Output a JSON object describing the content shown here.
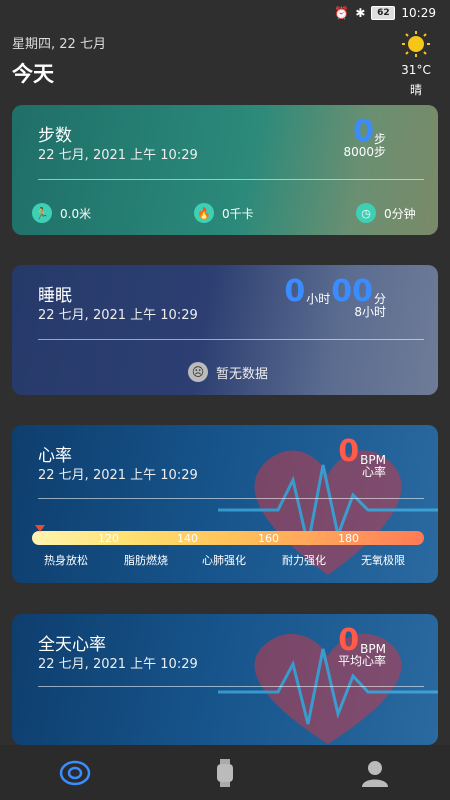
{
  "status": {
    "time": "10:29",
    "battery": "62"
  },
  "header": {
    "date": "星期四, 22 七月",
    "title": "今天"
  },
  "weather": {
    "temp": "31°C",
    "condition": "晴",
    "icon": "sun-icon"
  },
  "steps": {
    "title": "步数",
    "time": "22 七月, 2021 上午 10:29",
    "value": "0",
    "unit": "步",
    "goal": "8000步",
    "distance": "0.0米",
    "calories": "0千卡",
    "duration": "0分钟"
  },
  "sleep": {
    "title": "睡眠",
    "time": "22 七月, 2021 上午 10:29",
    "hours": "0",
    "hours_unit": "小时",
    "minutes": "00",
    "minutes_unit": "分",
    "goal": "8小时",
    "nodata": "暂无数据"
  },
  "heart": {
    "title": "心率",
    "time": "22 七月, 2021 上午 10:29",
    "value": "0",
    "unit": "BPM",
    "sub": "心率",
    "ticks": [
      "120",
      "140",
      "160",
      "180"
    ],
    "zones": [
      "热身放松",
      "脂肪燃烧",
      "心肺强化",
      "耐力强化",
      "无氧极限"
    ]
  },
  "allday_heart": {
    "title": "全天心率",
    "time": "22 七月, 2021 上午 10:29",
    "value": "0",
    "unit": "BPM",
    "sub": "平均心率"
  },
  "nav": {
    "items": [
      "home-icon",
      "watch-icon",
      "profile-icon"
    ]
  }
}
